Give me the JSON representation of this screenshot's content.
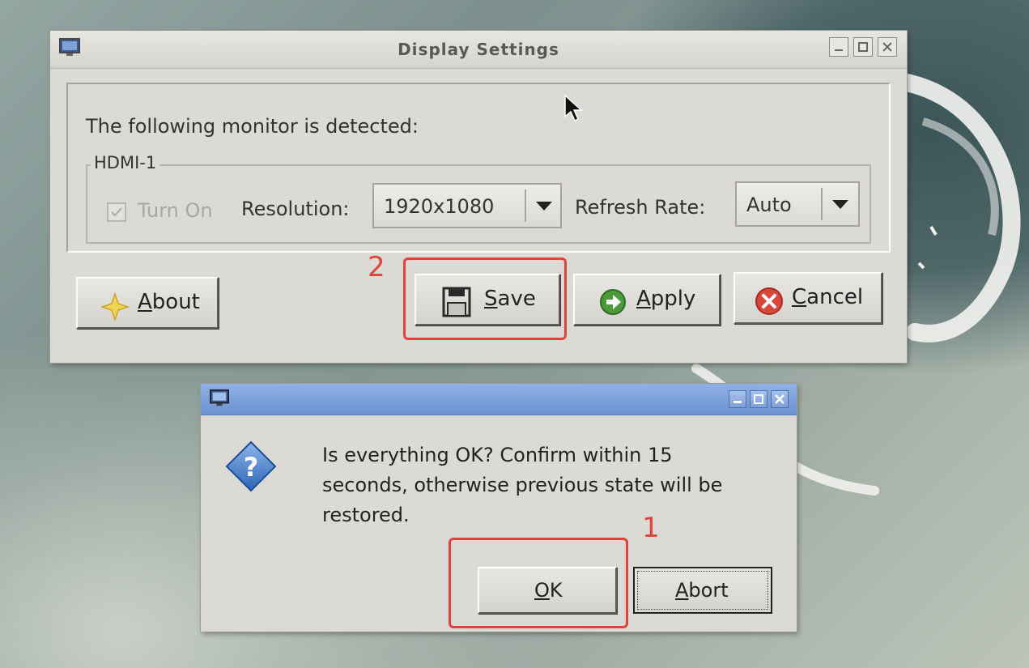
{
  "main_dialog": {
    "title": "Display Settings",
    "detected_text": "The following monitor is detected:",
    "monitor": {
      "name": "HDMI-1",
      "turn_on_label": "Turn On",
      "turn_on_checked": true,
      "turn_on_enabled": false,
      "resolution_label": "Resolution:",
      "resolution_value": "1920x1080",
      "refresh_rate_label": "Refresh Rate:",
      "refresh_rate_value": "Auto"
    },
    "buttons": {
      "about_mnemonic": "A",
      "about_rest": "bout",
      "save_mnemonic": "S",
      "save_rest": "ave",
      "apply_mnemonic": "A",
      "apply_rest": "pply",
      "cancel_mnemonic": "C",
      "cancel_rest": "ancel"
    }
  },
  "confirm_dialog": {
    "title": "",
    "message_lines": [
      "Is everything OK? Confirm within 15",
      "seconds, otherwise previous state will be",
      "restored."
    ],
    "buttons": {
      "ok_mnemonic": "O",
      "ok_rest": "K",
      "abort_mnemonic": "A",
      "abort_rest": "bort"
    }
  },
  "annotations": {
    "step_1": "1",
    "step_2": "2",
    "highlight_color": "#e0443c"
  }
}
